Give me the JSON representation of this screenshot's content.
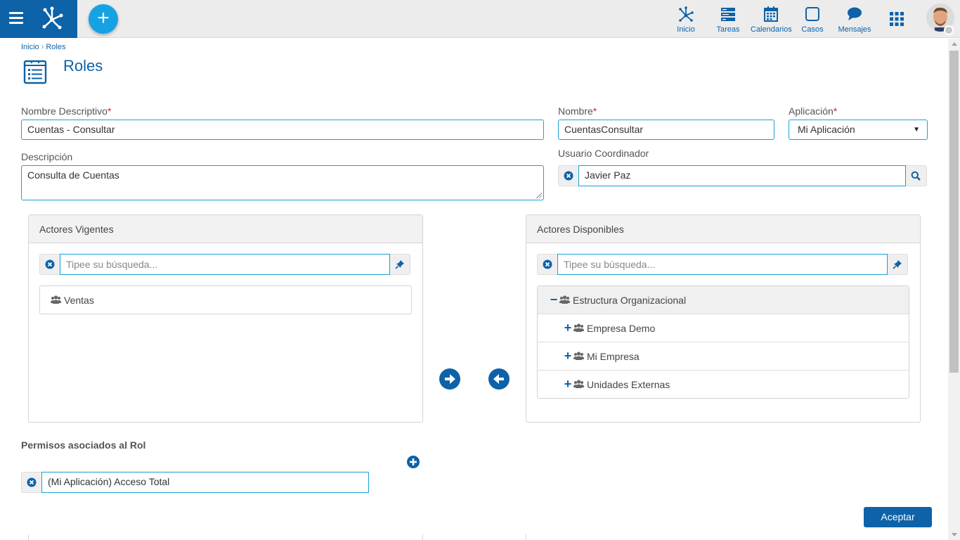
{
  "topbar": {
    "nav": [
      {
        "id": "inicio",
        "label": "Inicio",
        "icon": "process-icon"
      },
      {
        "id": "tareas",
        "label": "Tareas",
        "icon": "tasks-icon"
      },
      {
        "id": "calendarios",
        "label": "Calendarios",
        "icon": "calendar-icon"
      },
      {
        "id": "casos",
        "label": "Casos",
        "icon": "cases-icon"
      },
      {
        "id": "mensajes",
        "label": "Mensajes",
        "icon": "messages-icon"
      }
    ],
    "add_label": "+"
  },
  "breadcrumb": {
    "home": "Inicio",
    "sep": "›",
    "current": "Roles"
  },
  "page": {
    "title": "Roles"
  },
  "form": {
    "nombre_descriptivo": {
      "label": "Nombre Descriptivo",
      "req": "*",
      "value": "Cuentas - Consultar"
    },
    "nombre": {
      "label": "Nombre",
      "req": "*",
      "value": "CuentasConsultar"
    },
    "aplicacion": {
      "label": "Aplicación",
      "req": "*",
      "value": "Mi Aplicación",
      "caret": "▼"
    },
    "descripcion": {
      "label": "Descripción",
      "value": "Consulta de Cuentas"
    },
    "usuario_coordinador": {
      "label": "Usuario Coordinador",
      "value": "Javier Paz"
    }
  },
  "actores_vigentes": {
    "title": "Actores Vigentes",
    "search_placeholder": "Tipee su búsqueda...",
    "items": [
      {
        "label": "Ventas"
      }
    ]
  },
  "actores_disponibles": {
    "title": "Actores Disponibles",
    "search_placeholder": "Tipee su búsqueda...",
    "tree": [
      {
        "toggle": "−",
        "label": "Estructura Organizacional"
      },
      {
        "toggle": "+",
        "label": "Empresa Demo"
      },
      {
        "toggle": "+",
        "label": "Mi Empresa"
      },
      {
        "toggle": "+",
        "label": "Unidades Externas"
      }
    ]
  },
  "permisos": {
    "title": "Permisos asociados al Rol",
    "items": [
      {
        "value": "(Mi Aplicación) Acceso Total"
      }
    ]
  },
  "actions": {
    "accept": "Aceptar"
  },
  "colors": {
    "primary": "#0d62a8",
    "accent": "#15a2e3",
    "input_border": "#1aa0d8"
  }
}
